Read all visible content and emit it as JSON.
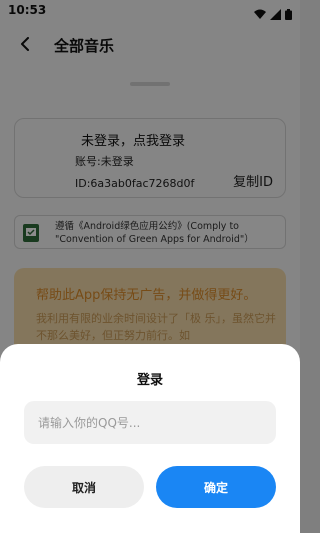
{
  "status_bar": {
    "time": "10:53",
    "icons": [
      "wifi-icon",
      "signal-icon",
      "battery-icon"
    ]
  },
  "app_bar": {
    "title": "全部音乐",
    "back_icon": "back-arrow-icon"
  },
  "account": {
    "status": "未登录，点我登录",
    "account_no": "账号:未登录",
    "id": "ID:6a3ab0fac7268d0f",
    "copy_label": "复制ID"
  },
  "green_apps": {
    "text": "遵循《Android绿色应用公约》(Comply to \"Convention of Green Apps for Android\"）",
    "icon": "green-app-icon"
  },
  "notice": {
    "title": "帮助此App保持无广告，并做得更好。",
    "body": "我利用有限的业余时间设计了「极 乐」，虽然它并不那么美好，但正努力前行。如"
  },
  "dialog": {
    "title": "登录",
    "input_placeholder": "请输入你的QQ号...",
    "input_value": "",
    "cancel_label": "取消",
    "confirm_label": "确定"
  },
  "colors": {
    "accent": "#1a86f4",
    "notice_bg": "#f0d7a8",
    "notice_title": "#d98a2b",
    "overlay": "rgba(0,0,0,0.45)"
  }
}
